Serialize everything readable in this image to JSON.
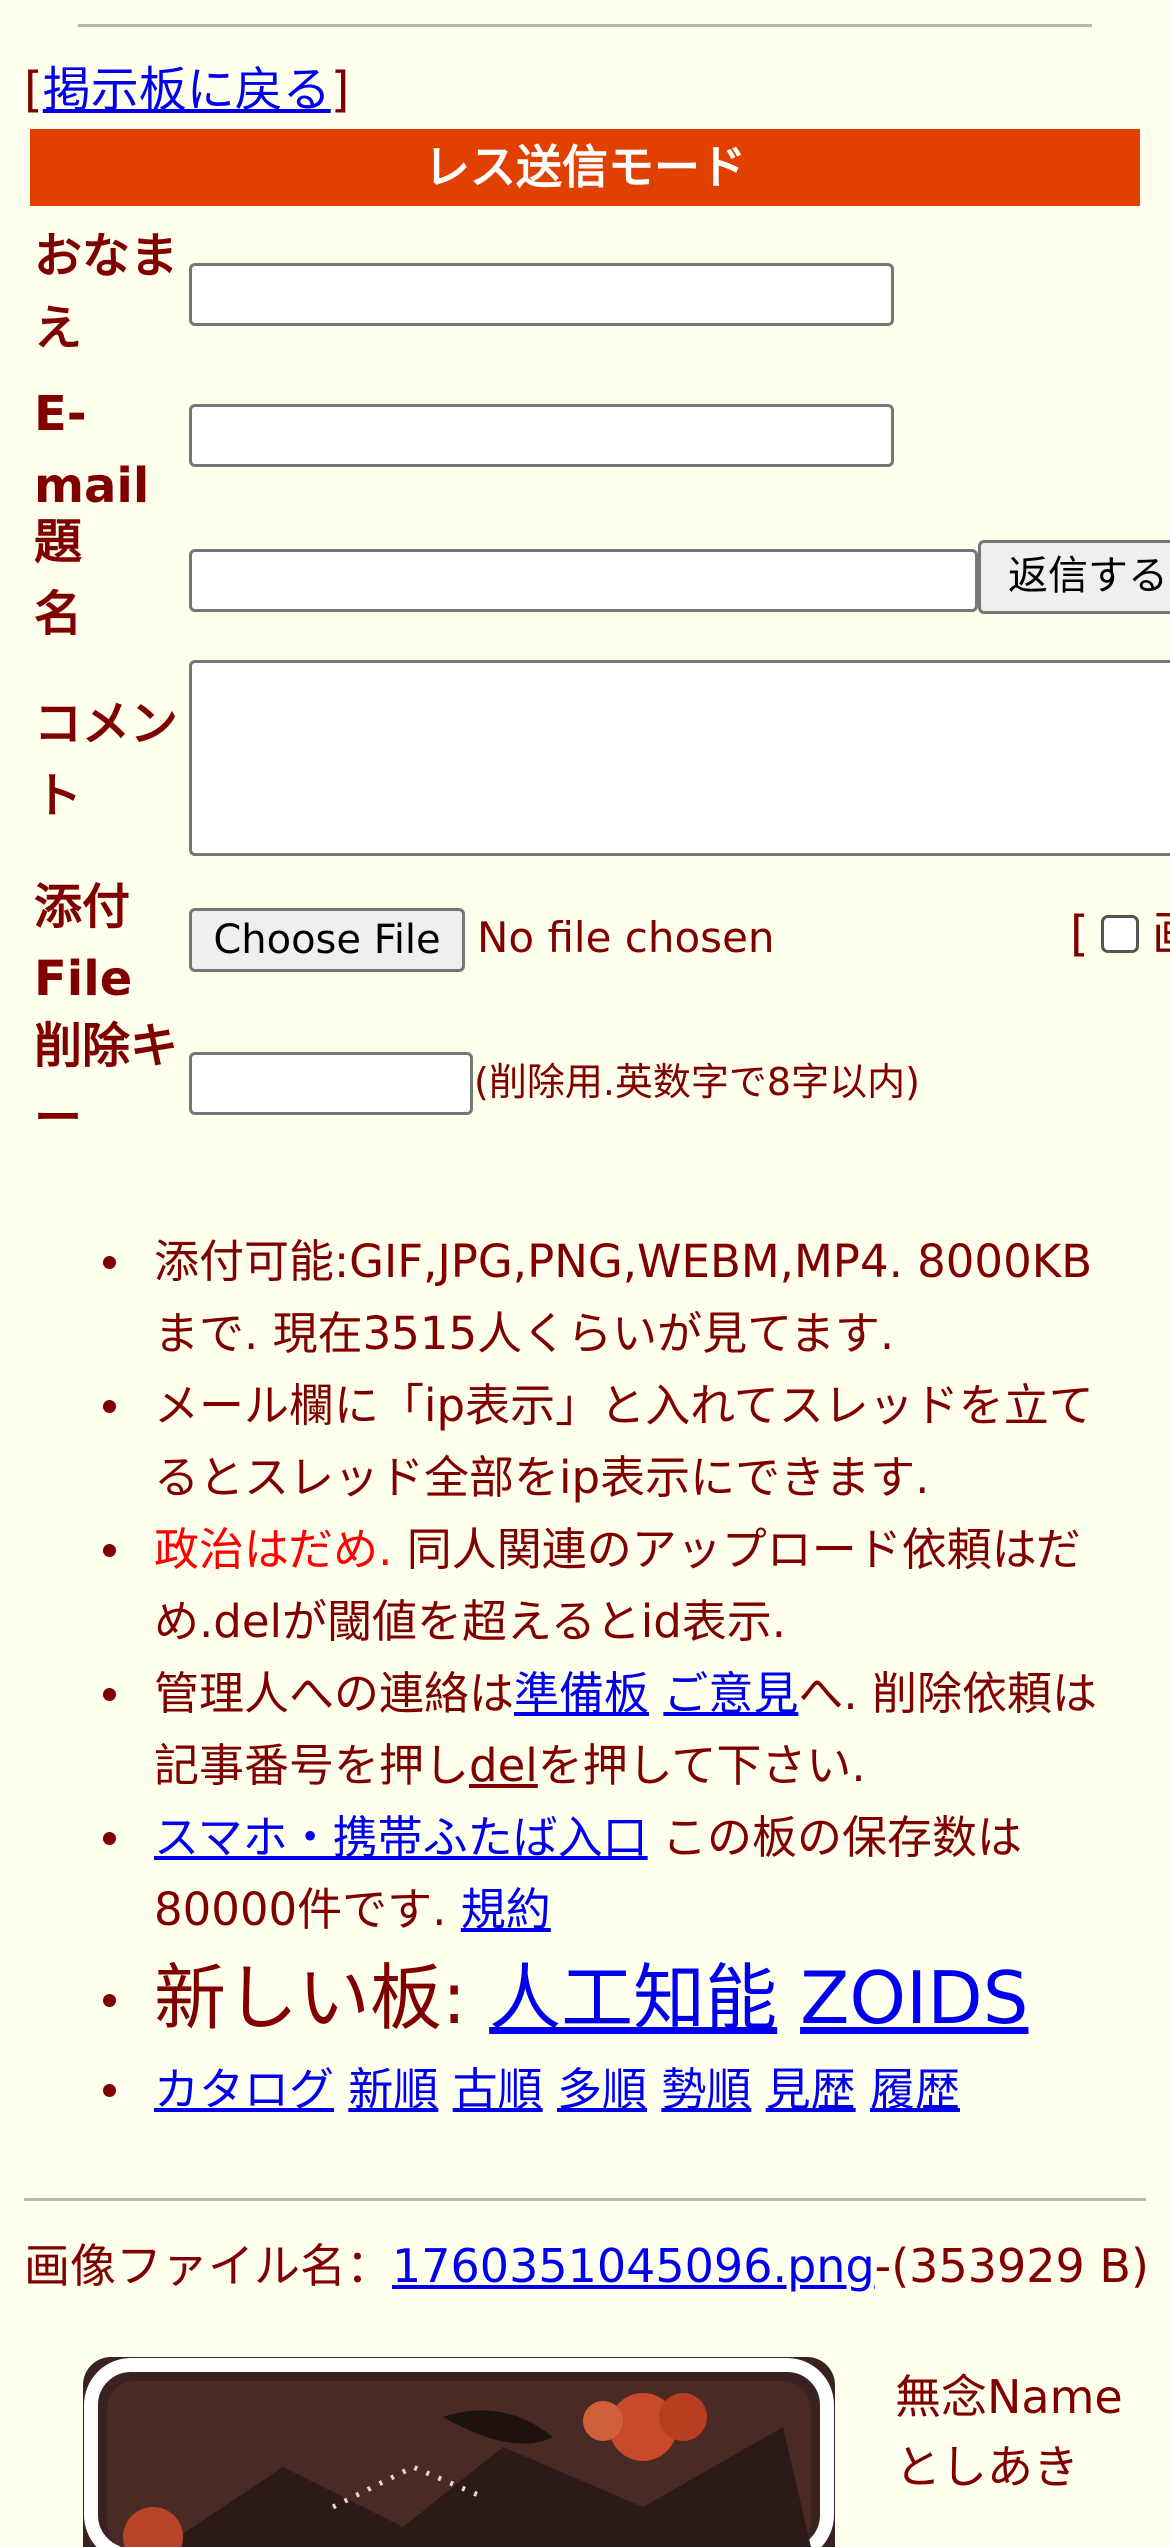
{
  "nav": {
    "back_open": "[",
    "back_link": "掲示板に戻る",
    "back_close": "]"
  },
  "mode_title": "レス送信モード",
  "form": {
    "name_label": "おなまえ",
    "email_label": "E-mail",
    "subject_label": "題名",
    "submit_label": "返信する",
    "comment_label": "コメント",
    "file_label": "添付File",
    "choose_file_label": "Choose File",
    "no_file_text": "No file chosen",
    "checkbox_bracket": "[",
    "checkbox_label": "画",
    "delkey_label": "削除キー",
    "delkey_note": "(削除用.英数字で8字以内)"
  },
  "info": {
    "line1": "添付可能:GIF,JPG,PNG,WEBM,MP4. 8000KBまで. 現在3515人くらいが見てます.",
    "line2": "メール欄に「ip表示」と入れてスレッドを立てるとスレッド全部をip表示にできます.",
    "line3_red": "政治はだめ.",
    "line3_rest": " 同人関連のアップロード依頼はだめ.delが閾値を超えるとid表示.",
    "line4_a": "管理人への連絡は",
    "line4_link1": "準備板",
    "line4_sp": " ",
    "line4_link2": "ご意見",
    "line4_b": "へ. 削除依頼は記事番号を押し",
    "line4_link3": "del",
    "line4_c": "を押して下さい.",
    "line5_link": "スマホ・携帯ふたば入口",
    "line5_text": " この板の保存数は80000件です. ",
    "line5_link2": "規約",
    "newboard_label": "新しい板: ",
    "newboard_link1": "人工知能",
    "newboard_link2": "ZOIDS",
    "catalog_links": [
      "カタログ",
      "新順",
      "古順",
      "多順",
      "勢順",
      "見歴",
      "履歴"
    ]
  },
  "post": {
    "image_label": "画像ファイル名：",
    "image_filename": "1760351045096.png",
    "image_size": "-(353929 B)",
    "poster_name": "無念Name",
    "poster_sub": "としあき"
  },
  "colors": {
    "background": "#ffffee",
    "text": "#800000",
    "mode_bar": "#e04000",
    "link": "#0000ee",
    "warning": "#ff0000"
  }
}
